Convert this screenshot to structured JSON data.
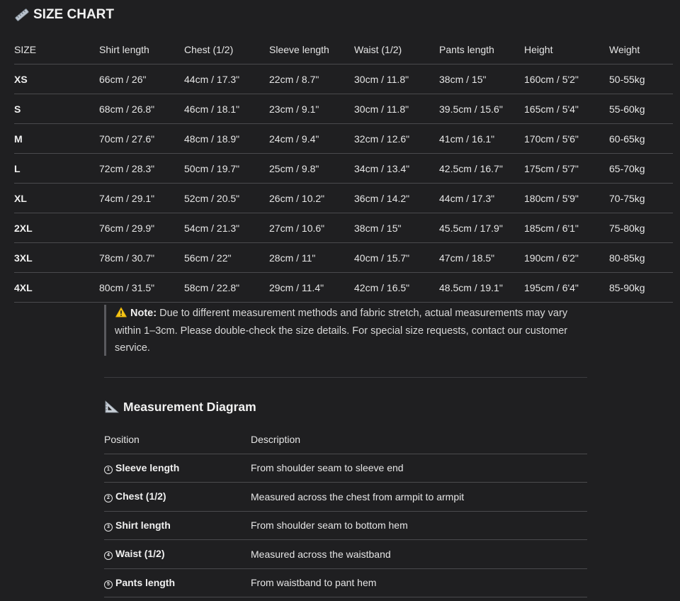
{
  "title": "SIZE CHART",
  "title_icon": "ruler-icon",
  "size_table": {
    "headers": [
      "SIZE",
      "Shirt length",
      "Chest (1/2)",
      "Sleeve length",
      "Waist (1/2)",
      "Pants length",
      "Height",
      "Weight"
    ],
    "rows": [
      [
        "XS",
        "66cm / 26\"",
        "44cm / 17.3\"",
        "22cm / 8.7\"",
        "30cm / 11.8\"",
        "38cm / 15\"",
        "160cm / 5'2\"",
        "50-55kg"
      ],
      [
        "S",
        "68cm / 26.8\"",
        "46cm / 18.1\"",
        "23cm / 9.1\"",
        "30cm / 11.8\"",
        "39.5cm / 15.6\"",
        "165cm / 5'4\"",
        "55-60kg"
      ],
      [
        "M",
        "70cm / 27.6\"",
        "48cm / 18.9\"",
        "24cm / 9.4\"",
        "32cm / 12.6\"",
        "41cm / 16.1\"",
        "170cm / 5'6\"",
        "60-65kg"
      ],
      [
        "L",
        "72cm / 28.3\"",
        "50cm / 19.7\"",
        "25cm / 9.8\"",
        "34cm / 13.4\"",
        "42.5cm / 16.7\"",
        "175cm / 5'7\"",
        "65-70kg"
      ],
      [
        "XL",
        "74cm / 29.1\"",
        "52cm / 20.5\"",
        "26cm / 10.2\"",
        "36cm / 14.2\"",
        "44cm / 17.3\"",
        "180cm / 5'9\"",
        "70-75kg"
      ],
      [
        "2XL",
        "76cm / 29.9\"",
        "54cm / 21.3\"",
        "27cm / 10.6\"",
        "38cm / 15\"",
        "45.5cm / 17.9\"",
        "185cm / 6'1\"",
        "75-80kg"
      ],
      [
        "3XL",
        "78cm / 30.7\"",
        "56cm / 22\"",
        "28cm / 11\"",
        "40cm / 15.7\"",
        "47cm / 18.5\"",
        "190cm / 6'2\"",
        "80-85kg"
      ],
      [
        "4XL",
        "80cm / 31.5\"",
        "58cm / 22.8\"",
        "29cm / 11.4\"",
        "42cm / 16.5\"",
        "48.5cm / 19.1\"",
        "195cm / 6'4\"",
        "85-90kg"
      ]
    ]
  },
  "note": {
    "icon": "warning-icon",
    "label": "Note:",
    "text": "Due to different measurement methods and fabric stretch, actual measurements may vary within 1–3cm. Please double-check the size details. For special size requests, contact our customer service."
  },
  "measurement": {
    "title": "Measurement Diagram",
    "title_icon": "triangular-ruler-icon",
    "headers": [
      "Position",
      "Description"
    ],
    "rows": [
      {
        "num": "1",
        "position": "Sleeve length",
        "description": "From shoulder seam to sleeve end"
      },
      {
        "num": "2",
        "position": "Chest (1/2)",
        "description": "Measured across the chest from armpit to armpit"
      },
      {
        "num": "3",
        "position": "Shirt length",
        "description": "From shoulder seam to bottom hem"
      },
      {
        "num": "4",
        "position": "Waist (1/2)",
        "description": "Measured across the waistband"
      },
      {
        "num": "5",
        "position": "Pants length",
        "description": "From waistband to pant hem"
      }
    ]
  },
  "colors": {
    "background": "#1f1f21",
    "text": "#ececec",
    "border": "#4a4a4d"
  }
}
